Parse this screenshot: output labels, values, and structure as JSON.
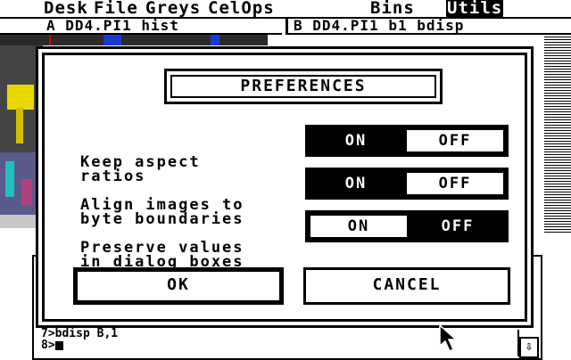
{
  "menubar": {
    "items": [
      "Desk",
      "File",
      "Greys",
      "CelOps",
      "Bins",
      "Utils"
    ],
    "active": "Utils"
  },
  "windows": {
    "a": {
      "title": "A DD4.PI1 hist"
    },
    "b": {
      "title": "B DD4.PI1 b1 bdisp"
    }
  },
  "console": {
    "line1": "7>bdisp B,1",
    "line2": "8>"
  },
  "dialog": {
    "title": "PREFERENCES",
    "preferences": [
      {
        "label_lines": [
          "Keep aspect",
          "ratios"
        ],
        "on_label": "ON",
        "off_label": "OFF",
        "value": "ON"
      },
      {
        "label_lines": [
          "Align images to",
          "byte boundaries"
        ],
        "on_label": "ON",
        "off_label": "OFF",
        "value": "ON"
      },
      {
        "label_lines": [
          "Preserve values",
          "in dialog boxes"
        ],
        "on_label": "ON",
        "off_label": "OFF",
        "value": "OFF"
      }
    ],
    "ok_label": "OK",
    "cancel_label": "CANCEL"
  },
  "icons": {
    "scroll_down": "arrow-down-icon",
    "pointer": "mouse-pointer-icon"
  },
  "colors": {
    "foreground": "#000000",
    "background": "#ffffff"
  }
}
